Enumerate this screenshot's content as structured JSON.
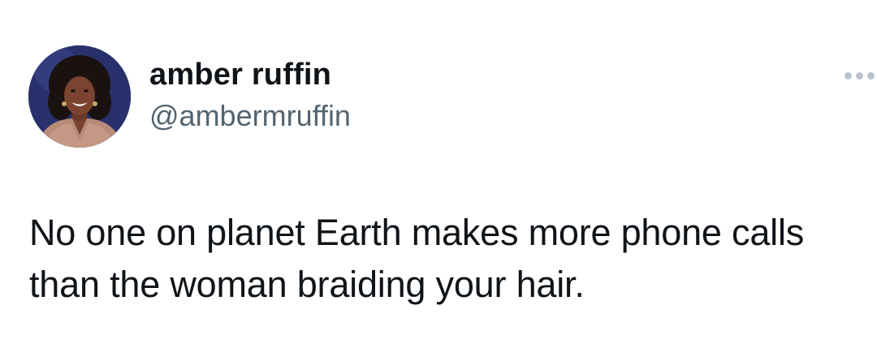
{
  "tweet": {
    "author": {
      "display_name": "amber ruffin",
      "handle": "@ambermruffin",
      "avatar_icon": "profile-photo"
    },
    "more_icon": "more-options-icon",
    "text_lines": [
      "No one on planet Earth makes more phone calls",
      "than the woman braiding your hair."
    ]
  },
  "colors": {
    "text_primary": "#0f1419",
    "text_secondary": "#536471",
    "more_dots": "#b9c3ce",
    "background": "#ffffff"
  }
}
